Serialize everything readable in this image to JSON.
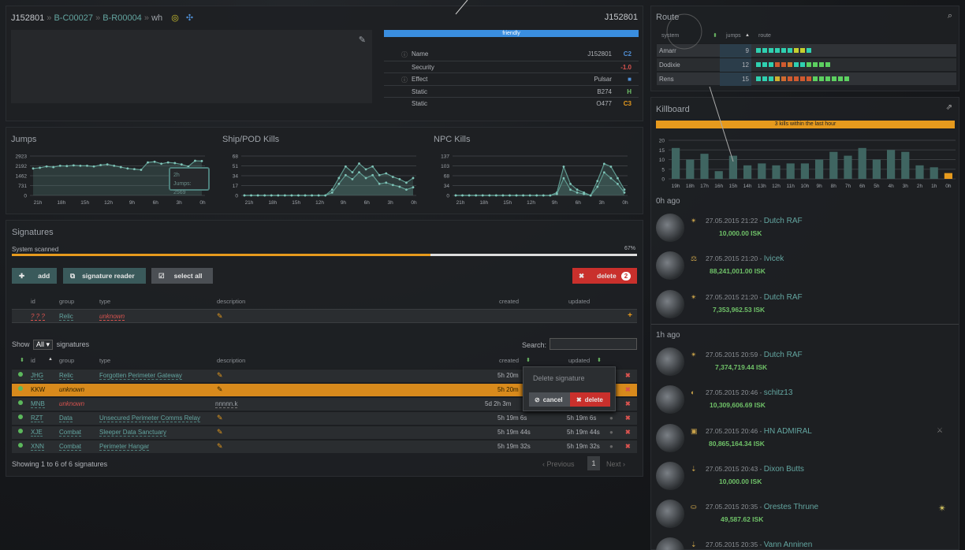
{
  "header": {
    "breadcrumb": [
      "J152801",
      "B-C00027",
      "B-R00004",
      "wh"
    ],
    "system_name": "J152801"
  },
  "system_info": {
    "status": "friendly",
    "rows": [
      {
        "label": "Name",
        "value": "J152801",
        "extra": "C2",
        "extra_color": "#4f8ed4"
      },
      {
        "label": "Security",
        "value": "",
        "extra": "-1.0",
        "extra_color": "#d9534f"
      },
      {
        "label": "Effect",
        "value": "Pulsar",
        "extra": "■",
        "extra_color": "#4f8ed4"
      },
      {
        "label": "Static",
        "value": "B274",
        "extra": "H",
        "extra_color": "#6fc168"
      },
      {
        "label": "Static",
        "value": "O477",
        "extra": "C3",
        "extra_color": "#e69a1d"
      }
    ]
  },
  "graphs": [
    {
      "title": "Jumps",
      "yticks": [
        "2923",
        "2192",
        "1462",
        "731",
        "0"
      ],
      "xticks": [
        "21h",
        "18h",
        "15h",
        "12h",
        "9h",
        "6h",
        "3h",
        "0h"
      ],
      "tooltip": [
        "2h",
        "Jumps: 2569"
      ]
    },
    {
      "title": "Ship/POD Kills",
      "yticks": [
        "68",
        "51",
        "34",
        "17",
        "0"
      ],
      "xticks": [
        "21h",
        "18h",
        "15h",
        "12h",
        "9h",
        "6h",
        "3h",
        "0h"
      ]
    },
    {
      "title": "NPC Kills",
      "yticks": [
        "137",
        "103",
        "68",
        "34",
        "0"
      ],
      "xticks": [
        "21h",
        "18h",
        "15h",
        "12h",
        "9h",
        "6h",
        "3h",
        "0h"
      ]
    }
  ],
  "signatures": {
    "title": "Signatures",
    "scanned_label": "System scanned",
    "scanned_pct": "67%",
    "scanned_value": 0.67,
    "buttons": {
      "add": "add",
      "reader": "signature reader",
      "select_all": "select all",
      "delete": "delete",
      "delete_count": "2"
    },
    "new_headers": [
      "id",
      "group",
      "type",
      "description",
      "created",
      "updated"
    ],
    "new_row": {
      "id": "? ? ?",
      "group": "Relic",
      "type": "unknown"
    },
    "show_label": "Show",
    "show_value": "All",
    "show_suffix": "signatures",
    "search_label": "Search:",
    "headers": [
      "id",
      "group",
      "type",
      "description",
      "created",
      "updated"
    ],
    "rows": [
      {
        "id": "JHG",
        "group": "Relic",
        "type": "Forgotten Perimeter Gateway",
        "desc": "",
        "created": "5h 20m",
        "updated": ""
      },
      {
        "id": "KKW",
        "group": "unknown",
        "type": "",
        "desc": "",
        "created": "5h 20m",
        "updated": ""
      },
      {
        "id": "MNB",
        "group": "unknown",
        "type": "",
        "desc": "nnnnn.k",
        "created": "5d  2h  3m",
        "updated": ""
      },
      {
        "id": "RZT",
        "group": "Data",
        "type": "Unsecured Perimeter Comms Relay",
        "desc": "",
        "created": "5h 19m  6s",
        "updated": "5h 19m  6s"
      },
      {
        "id": "XJE",
        "group": "Combat",
        "type": "Sleeper Data Sanctuary",
        "desc": "",
        "created": "5h 19m  44s",
        "updated": "5h 19m  44s"
      },
      {
        "id": "XNN",
        "group": "Combat",
        "type": "Perimeter Hangar",
        "desc": "",
        "created": "5h 19m  32s",
        "updated": "5h 19m  32s"
      }
    ],
    "popover": {
      "title": "Delete signature",
      "cancel": "cancel",
      "delete": "delete"
    },
    "footer": "Showing 1 to 6 of 6 signatures",
    "pager": {
      "prev": "Previous",
      "page": "1",
      "next": "Next"
    }
  },
  "route": {
    "title": "Route",
    "headers": [
      "system",
      "jumps",
      "route"
    ],
    "rows": [
      {
        "system": "Amarr",
        "jumps": "9",
        "colors": [
          "#2fd0b0",
          "#2fd0b0",
          "#2fd0b0",
          "#2fd0b0",
          "#2fd0b0",
          "#2fd0b0",
          "#c6d02f",
          "#c6d02f",
          "#2fd0b0"
        ]
      },
      {
        "system": "Dodixie",
        "jumps": "12",
        "colors": [
          "#2fd0b0",
          "#2fd0b0",
          "#2fd0b0",
          "#d05a2f",
          "#d05a2f",
          "#d07a2f",
          "#2fd0b0",
          "#2fd0b0",
          "#5cd060",
          "#5cd060",
          "#5cd060",
          "#5cd060"
        ]
      },
      {
        "system": "Rens",
        "jumps": "15",
        "colors": [
          "#2fd0b0",
          "#2fd0b0",
          "#2fd0b0",
          "#d0b02f",
          "#d06a2f",
          "#d05a2f",
          "#d05a2f",
          "#d05a2f",
          "#d05a2f",
          "#5cd060",
          "#5cd060",
          "#5cd060",
          "#5cd060",
          "#5cd060",
          "#5cd060"
        ]
      }
    ]
  },
  "killboard": {
    "title": "Killboard",
    "status": "3 kills within the last hour",
    "chart_data": {
      "type": "bar",
      "categories": [
        "19h",
        "18h",
        "17h",
        "16h",
        "15h",
        "14h",
        "13h",
        "12h",
        "11h",
        "10h",
        "9h",
        "8h",
        "7h",
        "6h",
        "5h",
        "4h",
        "3h",
        "2h",
        "1h",
        "0h"
      ],
      "values": [
        16,
        10,
        13,
        4,
        12,
        7,
        8,
        7,
        8,
        8,
        10,
        14,
        12,
        16,
        10,
        15,
        14,
        7,
        6,
        3
      ],
      "ylim": [
        0,
        20
      ],
      "yticks": [
        "20",
        "15",
        "10",
        "5",
        "0"
      ]
    },
    "groups": [
      {
        "label": "0h ago",
        "kills": [
          {
            "date": "27.05.2015 21:22",
            "name": "Dutch RAF",
            "isk": "10,000.00 ISK"
          },
          {
            "date": "27.05.2015 21:20",
            "name": "Ivicek",
            "isk": "88,241,001.00 ISK"
          },
          {
            "date": "27.05.2015 21:20",
            "name": "Dutch RAF",
            "isk": "7,353,962.53 ISK"
          }
        ]
      },
      {
        "label": "1h ago",
        "kills": [
          {
            "date": "27.05.2015 20:59",
            "name": "Dutch RAF",
            "isk": "7,374,719.44 ISK"
          },
          {
            "date": "27.05.2015 20:46",
            "name": "schitz13",
            "isk": "10,309,606.69 ISK"
          },
          {
            "date": "27.05.2015 20:46",
            "name": "HN ADMIRAL",
            "isk": "80,865,164.34 ISK"
          },
          {
            "date": "27.05.2015 20:43",
            "name": "Dixon Butts",
            "isk": "10,000.00 ISK"
          },
          {
            "date": "27.05.2015 20:35",
            "name": "Orestes Thrune",
            "isk": "49,587.62 ISK"
          },
          {
            "date": "27.05.2015 20:35",
            "name": "Vann Anninen",
            "isk": ""
          }
        ]
      }
    ]
  }
}
